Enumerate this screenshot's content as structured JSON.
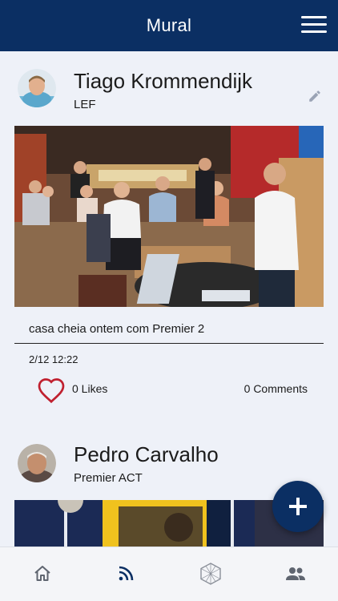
{
  "header": {
    "title": "Mural",
    "menu_icon": "hamburger-menu-icon"
  },
  "posts": [
    {
      "author": "Tiago Krommendijk",
      "subtitle": "LEF",
      "caption": "casa cheia ontem com Premier 2",
      "timestamp": "2/12 12:22",
      "likes": "0 Likes",
      "comments": "0 Comments",
      "edit_icon": "pencil-icon",
      "like_icon": "heart-outline-icon"
    },
    {
      "author": "Pedro Carvalho",
      "subtitle": "Premier ACT"
    }
  ],
  "fab": {
    "icon": "plus-icon"
  },
  "bottom_nav": [
    {
      "name": "home",
      "icon": "home-icon",
      "active": false
    },
    {
      "name": "feed",
      "icon": "rss-feed-icon",
      "active": true
    },
    {
      "name": "network",
      "icon": "hexagon-network-icon",
      "active": false
    },
    {
      "name": "people",
      "icon": "people-icon",
      "active": false
    }
  ],
  "colors": {
    "primary": "#0b2f63",
    "background": "#eef1f8",
    "heart": "#c0202f",
    "inactive_icon": "#5f6570"
  }
}
